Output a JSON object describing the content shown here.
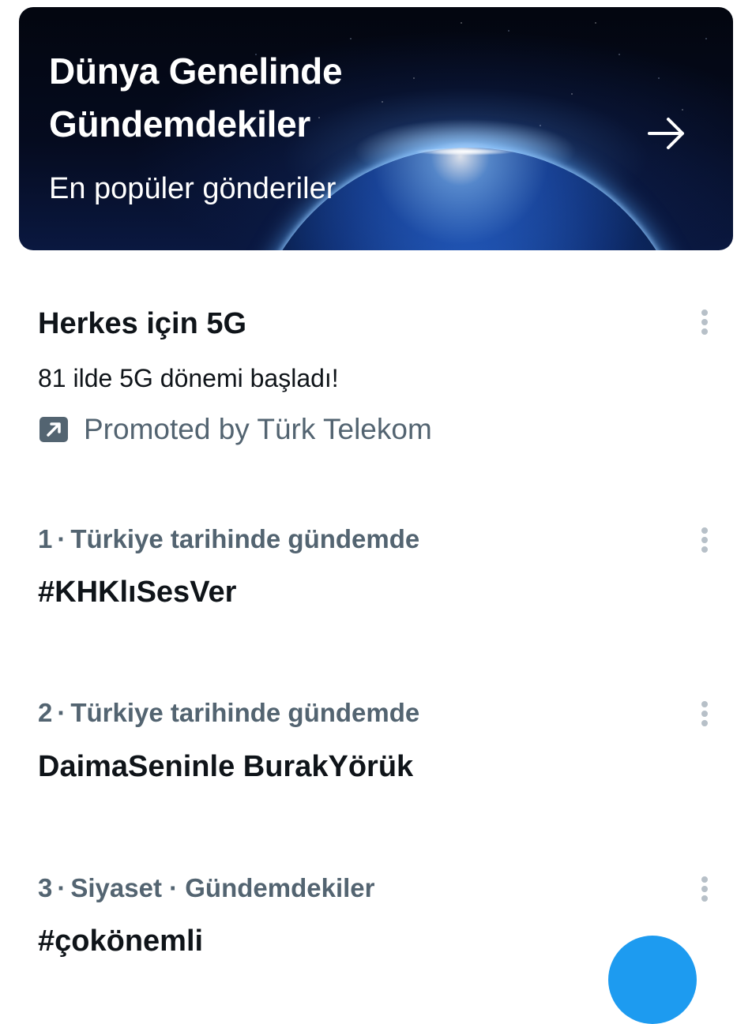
{
  "hero": {
    "title_line1": "Dünya Genelinde",
    "title_line2": "Gündemdekiler",
    "subtitle": "En popüler gönderiler",
    "arrow_icon": "arrow-right-icon"
  },
  "promoted": {
    "title": "Herkes için 5G",
    "description": "81 ilde 5G dönemi başladı!",
    "promoted_label": "Promoted by Türk Telekom",
    "promoted_icon": "promoted-arrow-icon",
    "menu_icon": "more-vertical-icon"
  },
  "trends": [
    {
      "rank": "1",
      "context": "Türkiye tarihinde gündemde",
      "name": "#KHKlıSesVer",
      "menu_icon": "more-vertical-icon"
    },
    {
      "rank": "2",
      "context": "Türkiye tarihinde gündemde",
      "name": "DaimaSeninle BurakYörük",
      "menu_icon": "more-vertical-icon"
    },
    {
      "rank": "3",
      "context": "Siyaset · Gündemdekiler",
      "name": "#çokönemli",
      "menu_icon": "more-vertical-icon"
    }
  ],
  "separator": "·",
  "fab": {
    "icon": "compose-icon"
  },
  "colors": {
    "primary_text": "#0f1419",
    "secondary_text": "#536471",
    "kebab": "#b7c0c8",
    "accent": "#1d9bf0",
    "hero_background": "#050b1f"
  }
}
